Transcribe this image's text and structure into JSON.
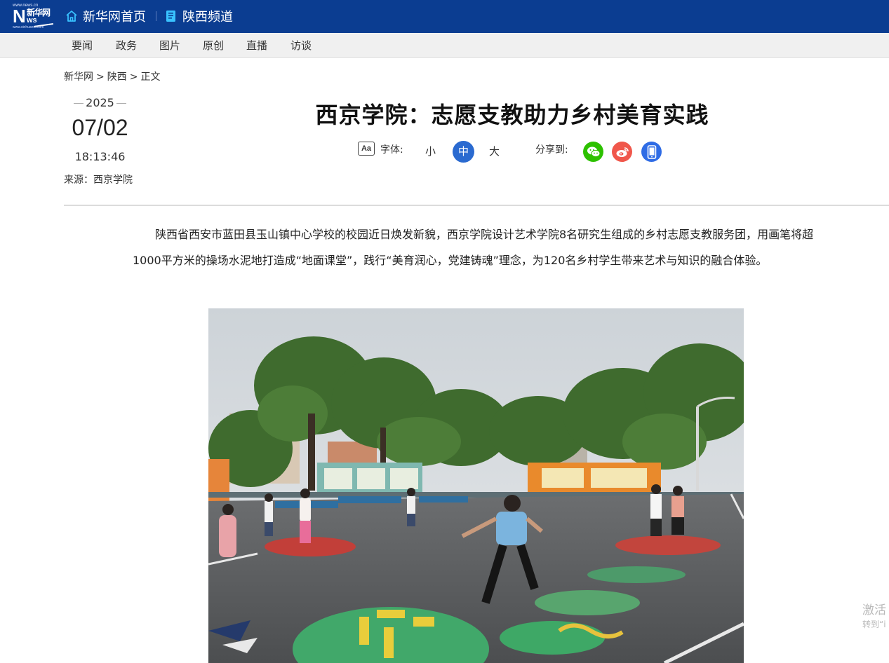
{
  "header": {
    "logo": {
      "top_text": "www.news.cn",
      "brand_cn": "新华网",
      "n": "N",
      "ws": "ws",
      "bottom_text": "www.xinhuanet.com"
    },
    "home_link": "新华网首页",
    "channel_link": "陕西频道"
  },
  "subnav": [
    "要闻",
    "政务",
    "图片",
    "原创",
    "直播",
    "访谈"
  ],
  "breadcrumb": [
    "新华网",
    ">",
    "陕西",
    ">",
    "正文"
  ],
  "article": {
    "year": "2025",
    "month_day": "07/02",
    "time": "18:13:46",
    "source": "来源：西京学院",
    "title": "西京学院：志愿支教助力乡村美育实践",
    "font_label": "字体:",
    "font_icon_text": "Aa",
    "size_small": "小",
    "size_medium": "中",
    "size_large": "大",
    "share_label": "分享到:",
    "paragraph": "陕西省西安市蓝田县玉山镇中心学校的校园近日焕发新貌，西京学院设计艺术学院8名研究生组成的乡村志愿支教服务团，用画笔将超1000平方米的操场水泥地打造成“地面课堂”，践行“美育润心，党建铸魂”理念，为120名乡村学生带来艺术与知识的融合体验。"
  },
  "icons": {
    "home": "home-icon",
    "channel": "book-icon",
    "font": "font-size-icon",
    "wechat": "wechat-icon",
    "weibo": "weibo-icon",
    "mobile": "mobile-icon"
  },
  "colors": {
    "header_bg": "#0b3d91",
    "active_size": "#2a6ad0",
    "wechat": "#2dc100",
    "weibo": "#f0574b",
    "mobile": "#2f6ce5"
  },
  "watermark": {
    "line1": "激活",
    "line2": "转到“i"
  }
}
